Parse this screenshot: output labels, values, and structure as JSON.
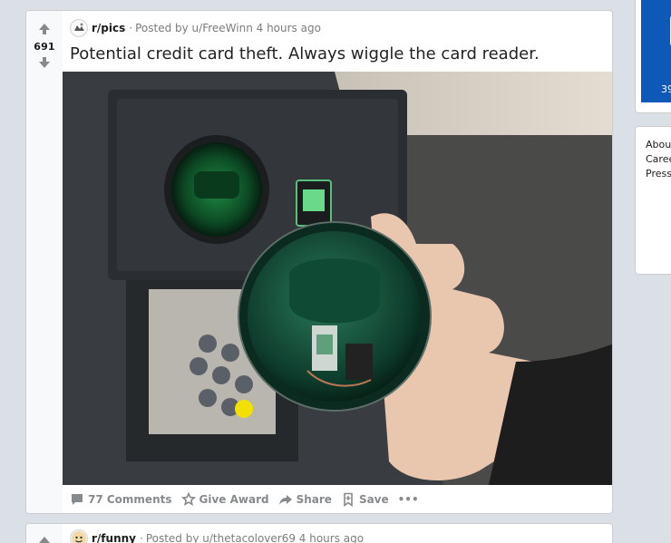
{
  "posts": [
    {
      "subreddit": "r/pics",
      "posted_by": "Posted by u/FreeWinn 4 hours ago",
      "score": "691",
      "title": "Potential credit card theft. Always wiggle the card reader.",
      "actions": {
        "comments": "77 Comments",
        "award": "Give Award",
        "share": "Share",
        "save": "Save",
        "more": "•••"
      }
    },
    {
      "subreddit": "r/funny",
      "posted_by": "Posted by u/thetacolover69 4 hours ago"
    }
  ],
  "sidebar": {
    "promo_count": "39",
    "links": [
      "Abou",
      "Caree",
      "Press"
    ]
  },
  "colors": {
    "background": "#dae0e6",
    "promo_blue": "#0e58b8",
    "action_gray": "#878a8c"
  }
}
